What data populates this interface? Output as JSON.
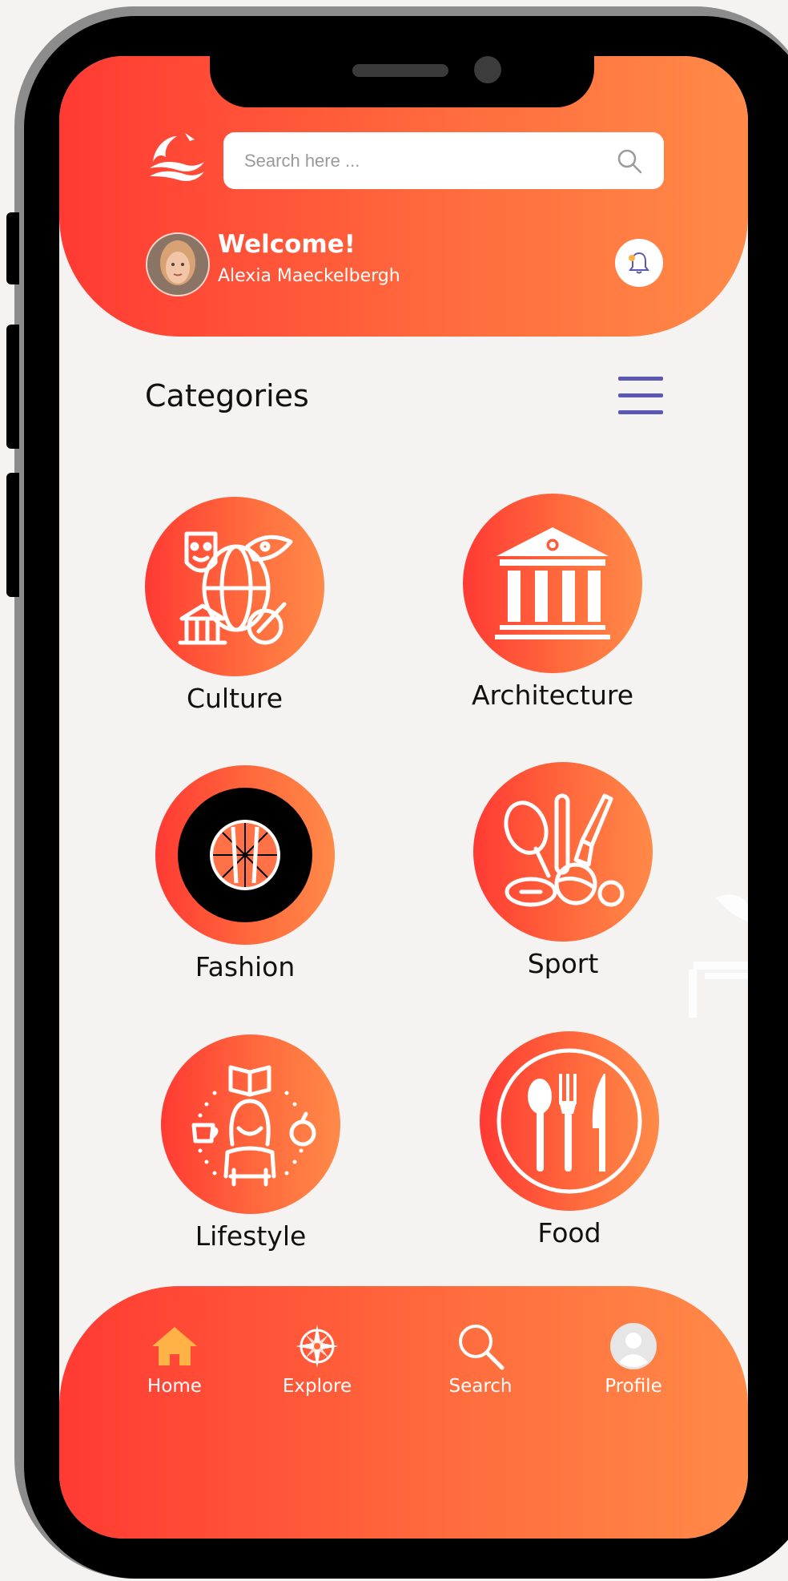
{
  "header": {
    "search_placeholder": "Search here ...",
    "welcome": "Welcome!",
    "user_name": "Alexia Maeckelbergh"
  },
  "categories": {
    "title": "Categories",
    "items": [
      {
        "label": "Culture",
        "icon": "culture-icon"
      },
      {
        "label": "Architecture",
        "icon": "architecture-icon"
      },
      {
        "label": "Fashion",
        "icon": "fashion-icon"
      },
      {
        "label": "Sport",
        "icon": "sport-icon"
      },
      {
        "label": "Lifestyle",
        "icon": "lifestyle-icon"
      },
      {
        "label": "Food",
        "icon": "food-icon"
      }
    ]
  },
  "bottom_nav": [
    {
      "label": "Home",
      "icon": "home-icon"
    },
    {
      "label": "Explore",
      "icon": "compass-icon"
    },
    {
      "label": "Search",
      "icon": "search-icon"
    },
    {
      "label": "Profile",
      "icon": "profile-icon"
    }
  ],
  "colors": {
    "gradient_start": "#ff3a33",
    "gradient_end": "#ff8a48",
    "menu_icon": "#5b57b5",
    "home_icon": "#ffb347"
  }
}
